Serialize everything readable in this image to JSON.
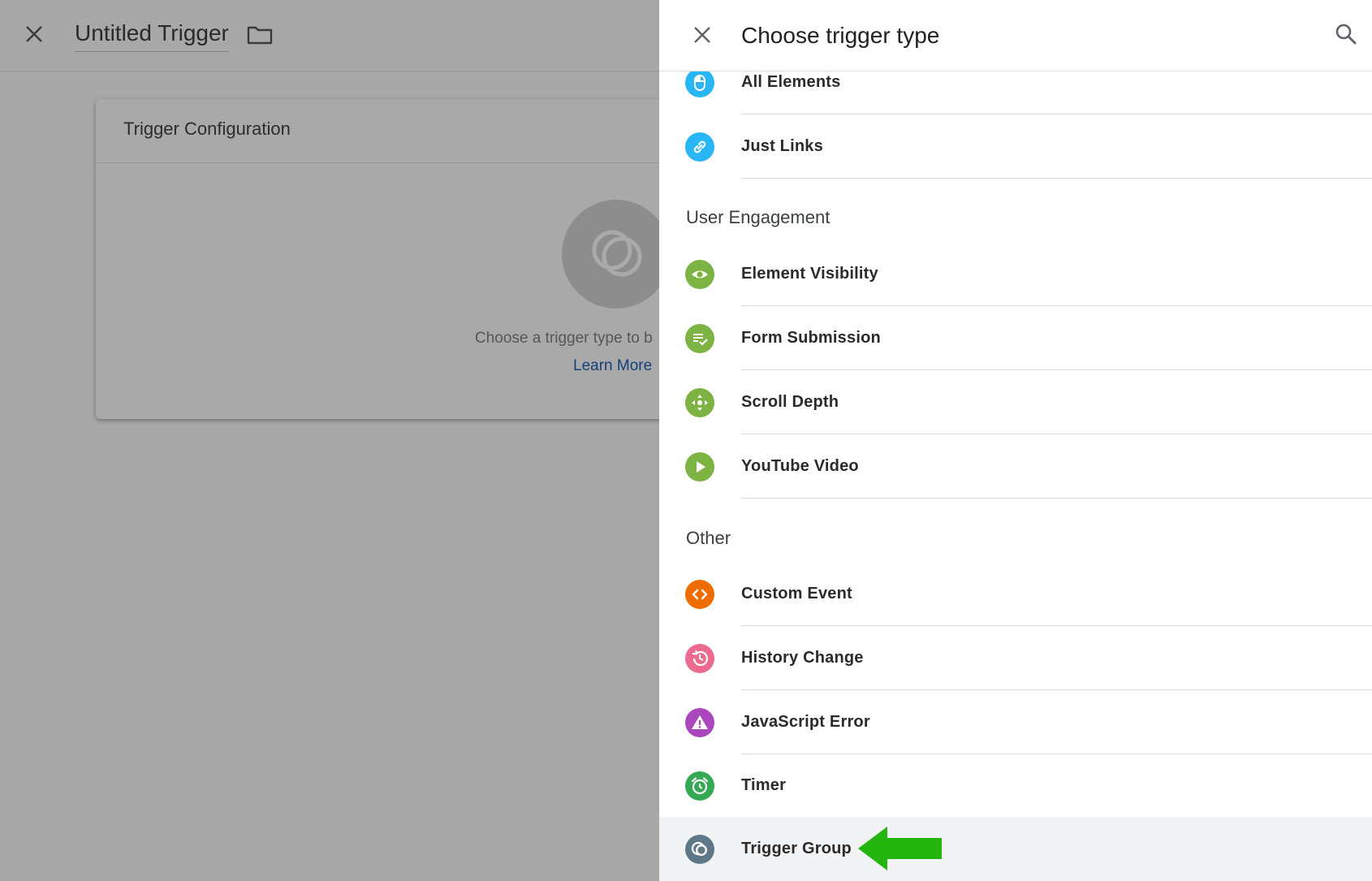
{
  "editor": {
    "trigger_name": "Untitled Trigger",
    "config_title": "Trigger Configuration",
    "config_hint": "Choose a trigger type to b",
    "learn_more": "Learn More"
  },
  "panel": {
    "title": "Choose trigger type",
    "sections": [
      {
        "label": "User Engagement"
      },
      {
        "label": "Other"
      }
    ],
    "items": [
      {
        "label": "All Elements",
        "icon": "mouse-icon",
        "color": "#29b6f6"
      },
      {
        "label": "Just Links",
        "icon": "link-icon",
        "color": "#29b6f6"
      },
      {
        "label": "Element Visibility",
        "icon": "eye-icon",
        "color": "#7cb342"
      },
      {
        "label": "Form Submission",
        "icon": "form-check-icon",
        "color": "#7cb342"
      },
      {
        "label": "Scroll Depth",
        "icon": "scroll-arrows-icon",
        "color": "#7cb342"
      },
      {
        "label": "YouTube Video",
        "icon": "play-icon",
        "color": "#7cb342"
      },
      {
        "label": "Custom Event",
        "icon": "code-icon",
        "color": "#ef6c00"
      },
      {
        "label": "History Change",
        "icon": "history-icon",
        "color": "#ec6b8e"
      },
      {
        "label": "JavaScript Error",
        "icon": "warning-icon",
        "color": "#ab47bc"
      },
      {
        "label": "Timer",
        "icon": "alarm-icon",
        "color": "#34a853"
      },
      {
        "label": "Trigger Group",
        "icon": "trigger-group-icon",
        "color": "#5f7888"
      }
    ]
  },
  "accent": {
    "arrow": "#24b50f"
  }
}
